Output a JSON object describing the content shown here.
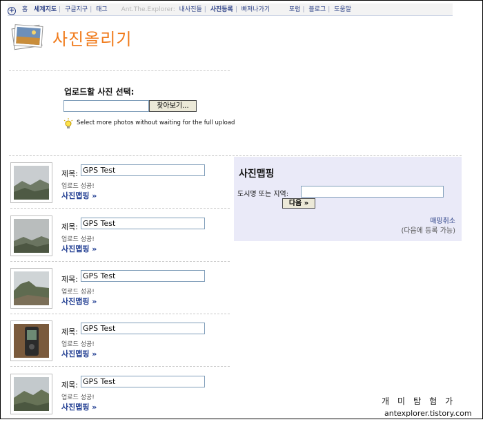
{
  "nav": {
    "home": "홈",
    "world_map": "세계지도",
    "google_earth": "구글지구",
    "tags": "태그",
    "user_prefix": "Ant.The.Explorer:",
    "my_photos": "내사진들",
    "upload": "사진등록",
    "explore": "빠져나가기",
    "forum": "포럼",
    "blog": "블로그",
    "help": "도움말"
  },
  "header": {
    "title": "사진올리기"
  },
  "upload": {
    "label": "업로드할 사진 선택:",
    "browse_label": "찾아보기...",
    "tip": "Select more photos without waiting for the full upload"
  },
  "items": [
    {
      "title_label": "제목:",
      "title_value": "GPS Test",
      "status": "업로드 성공!",
      "map_link": "사진맵핑 »"
    },
    {
      "title_label": "제목:",
      "title_value": "GPS Test",
      "status": "업로드 성공!",
      "map_link": "사진맵핑 »"
    },
    {
      "title_label": "제목:",
      "title_value": "GPS Test",
      "status": "업로드 성공!",
      "map_link": "사진맵핑 »"
    },
    {
      "title_label": "제목:",
      "title_value": "GPS Test",
      "status": "업로드 성공!",
      "map_link": "사진맵핑 »"
    },
    {
      "title_label": "제목:",
      "title_value": "GPS Test",
      "status": "업로드 성공!",
      "map_link": "사진맵핑 »"
    }
  ],
  "mapping": {
    "title": "사진맵핑",
    "location_label": "도시명 또는 지역:",
    "location_value": "",
    "next_label": "다음 »",
    "cancel_label": "매핑취소",
    "later_note": "(다음에 등록 가능)"
  },
  "watermark": {
    "handwriting": "개미탐험가",
    "url": "antexplorer.tistory.com"
  },
  "colors": {
    "accent": "#f07a1a",
    "link": "#1f3c91",
    "panel": "#eaeaf8"
  }
}
